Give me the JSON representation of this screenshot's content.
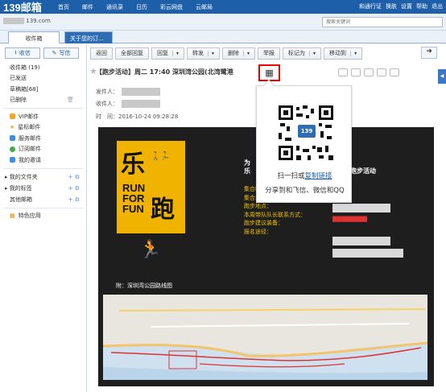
{
  "app": {
    "logo": "139邮箱"
  },
  "topnav": [
    "首页",
    "邮件",
    "通讯录",
    "日历",
    "彩云网盘",
    "云邮局"
  ],
  "topright": [
    "和通行证",
    "换肤",
    "设置",
    "帮助",
    "退出"
  ],
  "account": {
    "suffix": "139.com"
  },
  "search": {
    "placeholder": "搜索关键词"
  },
  "tabs": [
    "收件箱",
    "关于您的订..."
  ],
  "sidebar": {
    "receive": "收信",
    "write": "写信",
    "folders": [
      "收件箱 (19)",
      "已发送",
      "草稿箱[68]",
      "已删除"
    ],
    "special": [
      {
        "label": "VIP邮件",
        "color": "#f5a623"
      },
      {
        "label": "星标邮件",
        "color": "#f5a623"
      },
      {
        "label": "服务邮件",
        "color": "#3a8ee6"
      },
      {
        "label": "订阅邮件",
        "color": "#3fae49"
      },
      {
        "label": "我的邀请",
        "color": "#3a8ee6"
      }
    ],
    "groups": [
      "我的文件夹",
      "我的标签",
      "其他邮箱"
    ],
    "app": "特色应用"
  },
  "toolbar": [
    "返回",
    "全部回复",
    "回复",
    "转发",
    "删除",
    "举报",
    "标记为",
    "移动到"
  ],
  "mail": {
    "subject": "【跑步活动】周二 17:40 深圳湾公园(北湾鹭港",
    "from_label": "发件人：",
    "to_label": "收件人：",
    "time_label": "时　间：",
    "time_value": "2016-10-24  09:28:28"
  },
  "poster": {
    "logo_char1": "乐",
    "logo_char2": "跑",
    "logo_run": "RUN",
    "logo_for": "FOR",
    "logo_fun": "FUN",
    "route_label": "附：深圳湾公园路线图",
    "intro_1": "为",
    "intro_2": "乐",
    "intro_tail": "家进行跑步活动",
    "fields": [
      "集合时间：",
      "集合地点：",
      "跑步地点：",
      "本周带队队长联系方式：",
      "跑步建议装备：",
      "报名途径："
    ]
  },
  "popup": {
    "line1_prefix": "扫一扫或",
    "line1_link": "复制链接",
    "line2": "分享到和飞信、微信和QQ",
    "qr_logo": "139"
  }
}
